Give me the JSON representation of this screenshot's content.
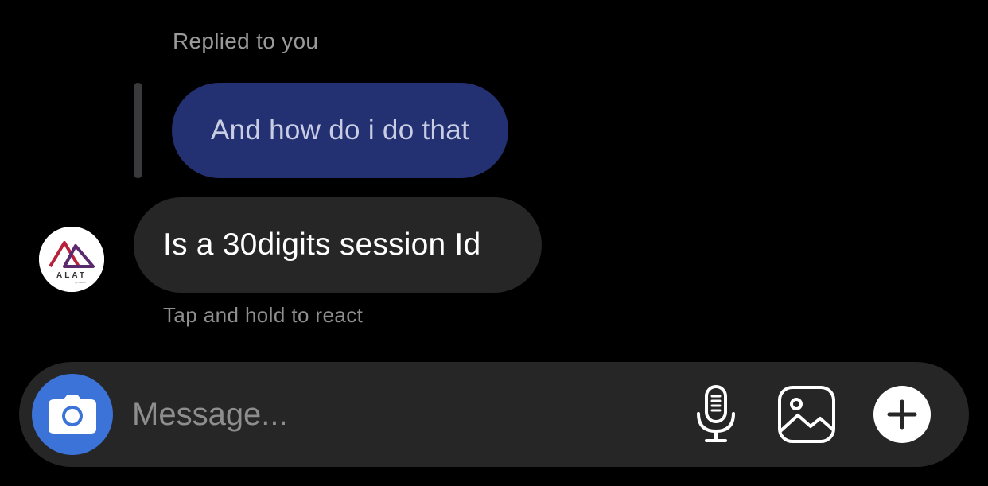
{
  "thread": {
    "replied_label": "Replied to you",
    "quoted_message": "And how do i do that",
    "incoming_message": "Is a 30digits session Id",
    "react_hint": "Tap and hold to react",
    "avatar": {
      "logo_text": "ALAT",
      "logo_subtext": "by WEMA",
      "icon": "alat-logo"
    }
  },
  "composer": {
    "placeholder": "Message...",
    "value": "",
    "icons": {
      "camera": "camera-icon",
      "mic": "microphone-icon",
      "gallery": "image-icon",
      "more": "plus-icon"
    }
  },
  "colors": {
    "background": "#000000",
    "quoted_bubble": "#233071",
    "incoming_bubble": "#262626",
    "composer": "#262626",
    "camera_button": "#3c73d9",
    "logo_red": "#b8213a",
    "logo_purple": "#5b2a6e"
  }
}
